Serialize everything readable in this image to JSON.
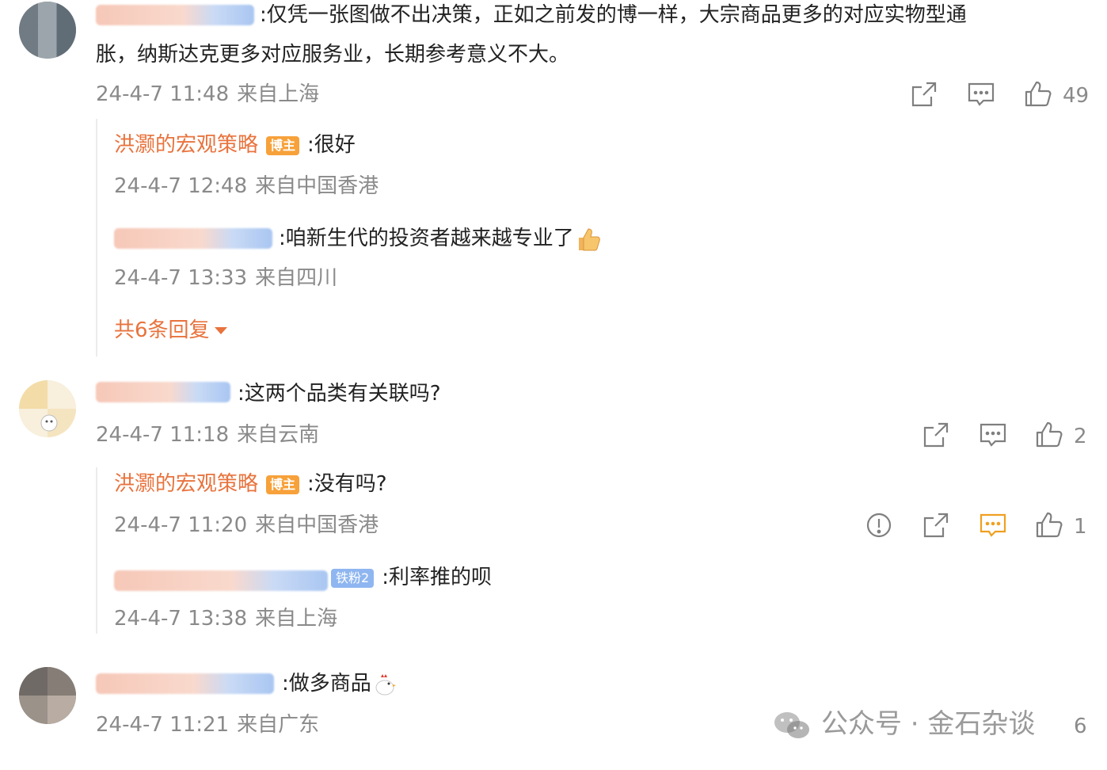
{
  "comments": [
    {
      "text": ":仅凭一张图做不出决策，正如之前发的博一样，大宗商品更多的对应实物型通",
      "text_line2": "胀，纳斯达克更多对应服务业，长期参考意义不大。",
      "time": "24-4-7 11:48",
      "location": "来自上海",
      "likes": "49",
      "replies": [
        {
          "author": "洪灏的宏观策略",
          "badge": "博主",
          "text": ":很好",
          "time": "24-4-7 12:48",
          "location": "来自中国香港"
        },
        {
          "text": ":咱新生代的投资者越来越专业了",
          "time": "24-4-7 13:33",
          "location": "来自四川"
        }
      ],
      "more_replies": "共6条回复"
    },
    {
      "text": ":这两个品类有关联吗?",
      "time": "24-4-7 11:18",
      "location": "来自云南",
      "likes": "2",
      "replies": [
        {
          "author": "洪灏的宏观策略",
          "badge": "博主",
          "text": ":没有吗?",
          "time": "24-4-7 11:20",
          "location": "来自中国香港",
          "likes": "1"
        },
        {
          "fan_badge": "铁粉2",
          "text": ":利率推的呗",
          "time": "24-4-7 13:38",
          "location": "来自上海"
        }
      ]
    },
    {
      "text": ":做多商品",
      "time": "24-4-7 11:21",
      "location": "来自广东",
      "likes": "6"
    }
  ],
  "watermark": "公众号 · 金石杂谈",
  "colors": {
    "blogger": "#e8733d",
    "meta": "#8a8a8a",
    "icon": "#7f7f7f",
    "active_comment_icon": "#f0a020"
  }
}
